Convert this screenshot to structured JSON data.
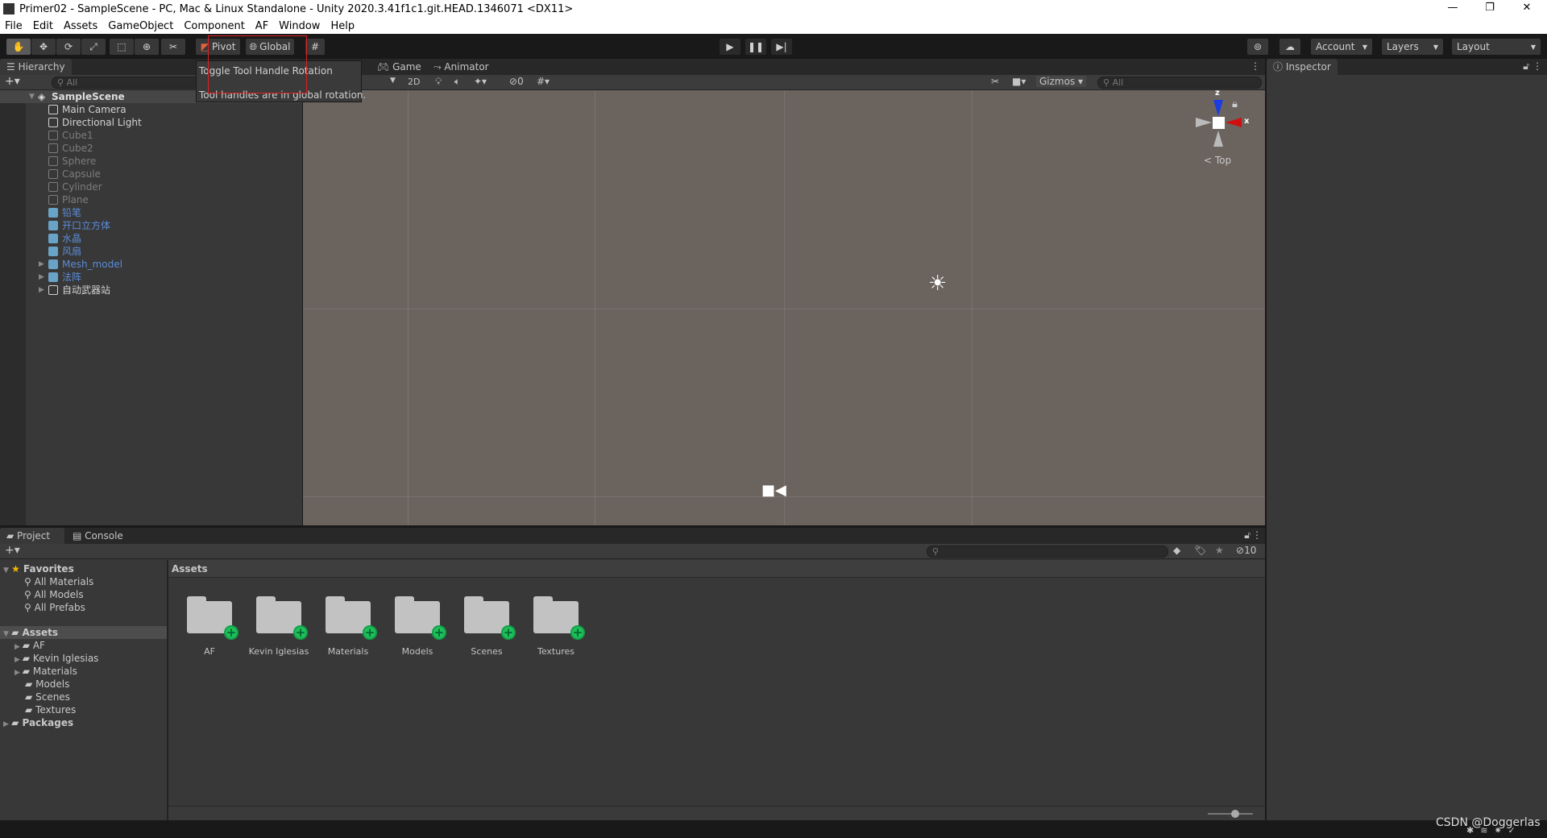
{
  "window": {
    "title": "Primer02 - SampleScene - PC, Mac & Linux Standalone - Unity 2020.3.41f1c1.git.HEAD.1346071 <DX11>",
    "minimize": "—",
    "restore": "❐",
    "close": "✕"
  },
  "menu": [
    "File",
    "Edit",
    "Assets",
    "GameObject",
    "Component",
    "AF",
    "Window",
    "Help"
  ],
  "toolbar": {
    "pivot": "Pivot",
    "global": "Global",
    "account": "Account",
    "layers": "Layers",
    "layout": "Layout",
    "play_icon": "play-icon",
    "pause_icon": "pause-icon",
    "step_icon": "step-icon"
  },
  "tooltip": {
    "title": "Toggle Tool Handle Rotation",
    "body": "Tool handles are in global rotation."
  },
  "hierarchy": {
    "tab": "Hierarchy",
    "search_placeholder": "All",
    "scene": "SampleScene",
    "items": [
      {
        "label": "Main Camera",
        "style": "white"
      },
      {
        "label": "Directional Light",
        "style": "white"
      },
      {
        "label": "Cube1",
        "style": "gray"
      },
      {
        "label": "Cube2",
        "style": "gray"
      },
      {
        "label": "Sphere",
        "style": "gray"
      },
      {
        "label": "Capsule",
        "style": "gray"
      },
      {
        "label": "Cylinder",
        "style": "gray"
      },
      {
        "label": "Plane",
        "style": "gray"
      },
      {
        "label": "铅笔",
        "style": "blue"
      },
      {
        "label": "开口立方体",
        "style": "blue"
      },
      {
        "label": "水晶",
        "style": "blue"
      },
      {
        "label": "风扇",
        "style": "blue"
      },
      {
        "label": "Mesh_model",
        "style": "blue",
        "expandable": true
      },
      {
        "label": "法阵",
        "style": "blue",
        "expandable": true
      },
      {
        "label": "自动武器站",
        "style": "white",
        "expandable": true
      }
    ]
  },
  "scene": {
    "tabs": [
      "Game",
      "Animator"
    ],
    "mode_2d": "2D",
    "hidden_count": "0",
    "gizmos": "Gizmos",
    "search_placeholder": "All",
    "orientation": "Top",
    "axis_x": "x",
    "axis_z": "z",
    "viewport_color": "#6b635e"
  },
  "inspector": {
    "tab": "Inspector"
  },
  "project": {
    "tabs": [
      "Project",
      "Console"
    ],
    "favorites": {
      "label": "Favorites",
      "items": [
        "All Materials",
        "All Models",
        "All Prefabs"
      ]
    },
    "assets_label": "Assets",
    "tree": [
      "AF",
      "Kevin Iglesias",
      "Materials",
      "Models",
      "Scenes",
      "Textures"
    ],
    "packages": "Packages",
    "breadcrumb": "Assets",
    "folders": [
      "AF",
      "Kevin Iglesias",
      "Materials",
      "Models",
      "Scenes",
      "Textures"
    ],
    "hidden_count": "10",
    "slider_value": 0.6
  },
  "watermark": "CSDN @Doggerlas"
}
